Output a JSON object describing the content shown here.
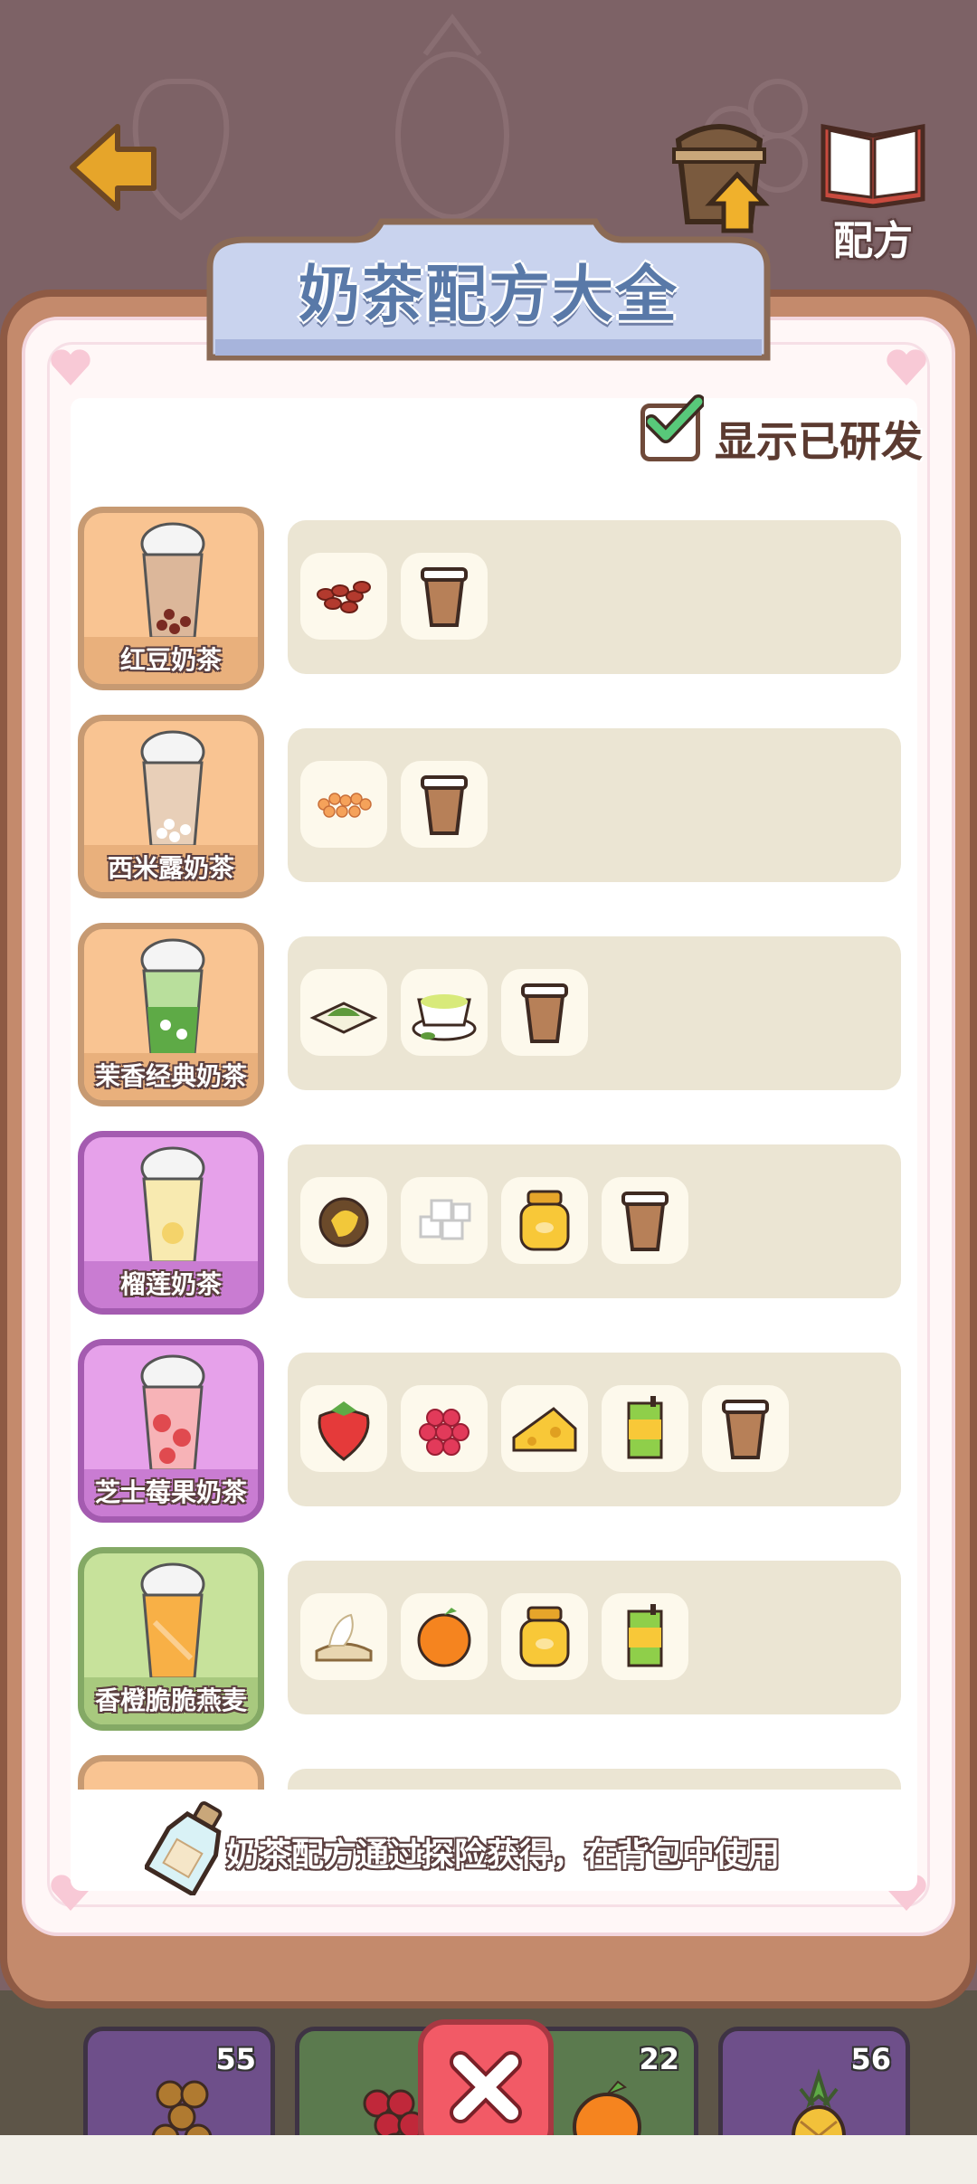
{
  "header": {
    "back_icon": "back-arrow-icon",
    "upgrade_icon": "cup-upgrade-icon",
    "upgrade_label": "",
    "recipe_icon": "open-book-icon",
    "recipe_label": "配方"
  },
  "panel": {
    "title": "奶茶配方大全",
    "toggle_label": "显示已研发",
    "toggle_checked": true
  },
  "recipes": [
    {
      "name": "红豆奶茶",
      "theme": "orange",
      "ingredients": [
        "red-bean-icon",
        "milk-tea-cup-icon"
      ]
    },
    {
      "name": "西米露奶茶",
      "theme": "orange",
      "ingredients": [
        "sago-icon",
        "milk-tea-cup-icon"
      ]
    },
    {
      "name": "茉香经典奶茶",
      "theme": "orange",
      "ingredients": [
        "matcha-powder-icon",
        "green-tea-cup-icon",
        "milk-tea-cup-icon"
      ]
    },
    {
      "name": "榴莲奶茶",
      "theme": "purple",
      "ingredients": [
        "durian-icon",
        "sugar-cubes-icon",
        "honey-jar-icon",
        "milk-tea-cup-icon"
      ]
    },
    {
      "name": "芝士莓果奶茶",
      "theme": "purple",
      "ingredients": [
        "strawberry-icon",
        "raspberry-icon",
        "cheese-icon",
        "juice-box-icon",
        "milk-tea-cup-icon"
      ]
    },
    {
      "name": "香橙脆脆燕麦",
      "theme": "green",
      "ingredients": [
        "oat-icon",
        "orange-icon",
        "honey-jar-icon",
        "juice-box-icon"
      ]
    }
  ],
  "hint": {
    "icon": "message-bottle-icon",
    "text": "奶茶配方通过探险获得，在背包中使用"
  },
  "bottom_slots": [
    {
      "icon": "tapioca-icon",
      "count": "55",
      "color": "#6e4f8a"
    },
    {
      "icon": "grape-icon",
      "count": "",
      "color": "#5b7a4e"
    },
    {
      "icon": "orange-icon",
      "count": "22",
      "color": "#5b7a4e"
    },
    {
      "icon": "pineapple-icon",
      "count": "56",
      "color": "#6e4f8a"
    }
  ],
  "close_icon": "close-x-icon"
}
